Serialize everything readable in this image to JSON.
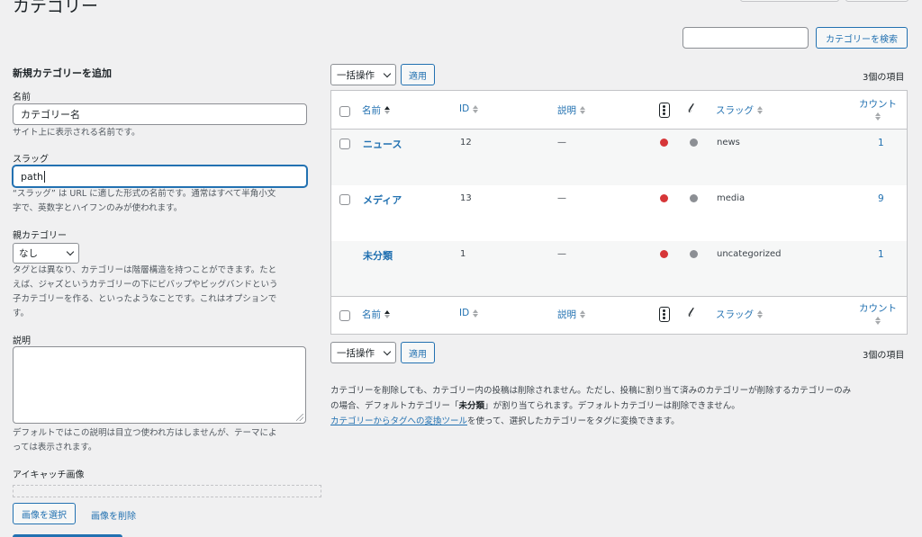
{
  "page": {
    "title": "カテゴリー"
  },
  "search": {
    "value": "",
    "button": "カテゴリーを検索"
  },
  "add_form": {
    "heading": "新規カテゴリーを追加",
    "name_label": "名前",
    "name_placeholder": "カテゴリー名",
    "name_help": "サイト上に表示される名前です。",
    "slug_label": "スラッグ",
    "slug_value": "path",
    "slug_help_1": "“スラッグ” は URL に適した形式の名前です。通常はすべて半角小文",
    "slug_help_2": "字で、英数字とハイフンのみが使われます。",
    "parent_label": "親カテゴリー",
    "parent_selected": "なし",
    "parent_help_1": "タグとは異なり、カテゴリーは階層構造を持つことができます。たと",
    "parent_help_2": "えば、ジャズというカテゴリーの下にビバップやビッグバンドという",
    "parent_help_3": "子カテゴリーを作る、といったようなことです。これはオプションで",
    "parent_help_4": "す。",
    "desc_label": "説明",
    "desc_value": "",
    "desc_help_1": "デフォルトではこの説明は目立つ使われ方はしませんが、テーマによ",
    "desc_help_2": "っては表示されます。",
    "image_label": "アイキャッチ画像",
    "select_image": "画像を選択",
    "remove_image": "画像を削除"
  },
  "bulk": {
    "selected": "一括操作",
    "apply": "適用",
    "items_count": "3個の項目"
  },
  "columns": {
    "name": "名前",
    "id": "ID",
    "description": "説明",
    "slug": "スラッグ",
    "count": "カウント"
  },
  "rows": [
    {
      "name": "ニュース",
      "id": "12",
      "description": "—",
      "slug": "news",
      "count": "1"
    },
    {
      "name": "メディア",
      "id": "13",
      "description": "—",
      "slug": "media",
      "count": "9"
    },
    {
      "name": "未分類",
      "id": "1",
      "description": "—",
      "slug": "uncategorized",
      "count": "1"
    }
  ],
  "footer": {
    "note_1": "カテゴリーを削除しても、カテゴリー内の投稿は削除されません。ただし、投稿に割り当て済みのカテゴリーが削除するカテゴリーのみ",
    "note_2a": "の場合、デフォルトカテゴリー「",
    "note_2b": "未分類",
    "note_2c": "」が割り当てられます。デフォルトカテゴリーは削除できません。",
    "link": "カテゴリーからタグへの変換ツール",
    "note_3": "を使って、選択したカテゴリーをタグに変換できます。"
  },
  "colors": {
    "accent": "#2271b1",
    "status_red": "#d63638",
    "status_gray": "#8c8f94"
  }
}
